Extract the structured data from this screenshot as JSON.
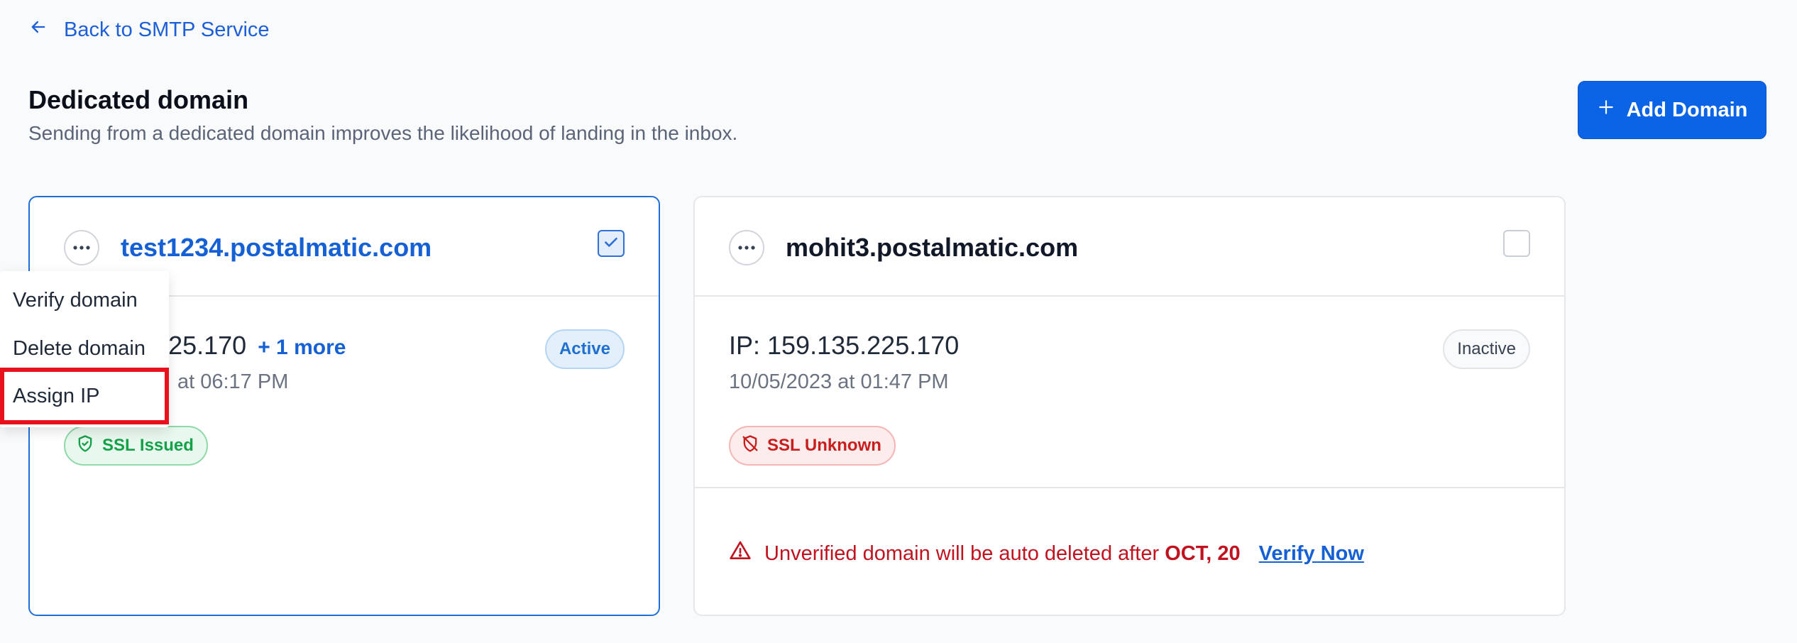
{
  "nav": {
    "back_label": "Back to SMTP Service"
  },
  "header": {
    "title": "Dedicated domain",
    "subtitle": "Sending from a dedicated domain improves the likelihood of landing in the inbox.",
    "add_button_label": "Add Domain"
  },
  "domains": [
    {
      "name": "test1234.postalmatic.com",
      "selected": true,
      "ip_partial": "35.225.170",
      "more_label": "+ 1 more",
      "date_partial": "at 06:17 PM",
      "status": "Active",
      "ssl": "SSL Issued"
    },
    {
      "name": "mohit3.postalmatic.com",
      "selected": false,
      "ip": "IP: 159.135.225.170",
      "date": "10/05/2023 at 01:47 PM",
      "status": "Inactive",
      "ssl": "SSL Unknown",
      "warning_text": "Unverified domain will be auto deleted after",
      "warning_date": "OCT, 20",
      "verify_label": "Verify Now"
    }
  ],
  "context_menu": {
    "items": [
      "Verify domain",
      "Delete domain",
      "Assign IP"
    ],
    "highlighted": "Assign IP"
  },
  "colors": {
    "accent": "#0b63e5",
    "active": "#1e6fd0",
    "success": "#15a04a",
    "danger": "#c81e1e",
    "highlight_border": "#e8121c"
  },
  "icons": [
    "arrow-left-icon",
    "plus-icon",
    "more-horizontal-icon",
    "check-icon",
    "shield-check-icon",
    "shield-off-icon",
    "warning-triangle-icon"
  ]
}
